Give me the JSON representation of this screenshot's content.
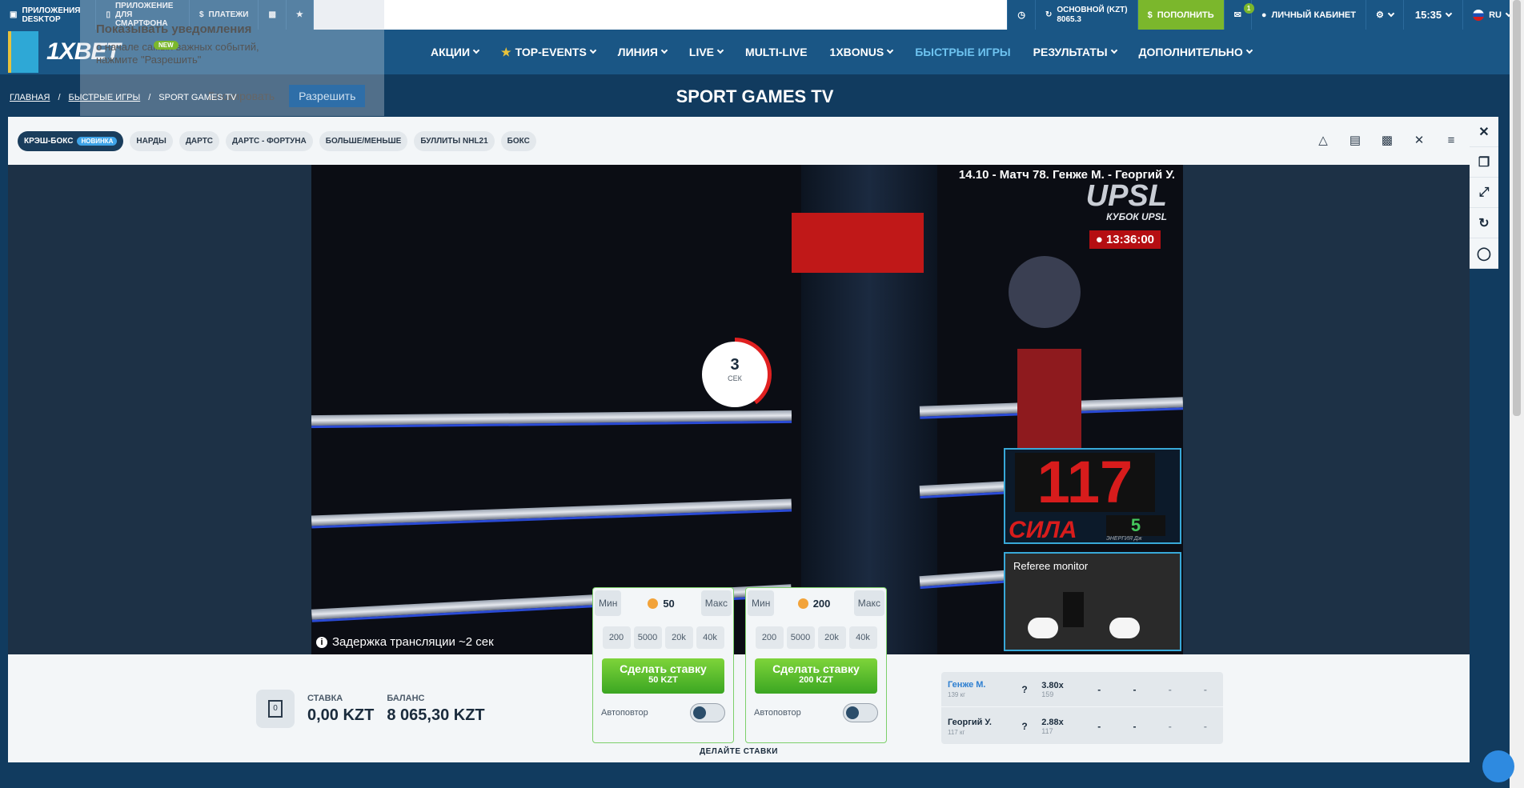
{
  "topbar": {
    "apps_desktop": "ПРИЛОЖЕНИЯ DESKTOP",
    "apps_phone": "ПРИЛОЖЕНИЕ ДЛЯ СМАРТФОНА",
    "payments": "ПЛАТЕЖИ",
    "account_type": "ОСНОВНОЙ (KZT)",
    "account_balance": "8065.3",
    "deposit": "ПОПОЛНИТЬ",
    "mail_count": "1",
    "cabinet": "ЛИЧНЫЙ КАБИНЕТ",
    "time": "15:35",
    "lang": "RU"
  },
  "logo": {
    "text": "1XBET",
    "badge": "NEW"
  },
  "nav": {
    "items": [
      "АКЦИИ",
      "TOP-EVENTS",
      "ЛИНИЯ",
      "LIVE",
      "MULTI-LIVE",
      "1XBONUS",
      "БЫСТРЫЕ ИГРЫ",
      "РЕЗУЛЬТАТЫ",
      "ДОПОЛНИТЕЛЬНО"
    ]
  },
  "notification": {
    "title": "Показывать уведомления",
    "text_line1": "о начале самых важных событий,",
    "text_line2": "нажмите \"Разрешить\"",
    "block": "Блокировать",
    "allow": "Разрешить"
  },
  "breadcrumb": {
    "home": "ГЛАВНАЯ",
    "fast_games": "БЫСТРЫЕ ИГРЫ",
    "current": "SPORT GAMES TV"
  },
  "page_title": "SPORT GAMES TV",
  "games": {
    "tabs": [
      "КРЭШ-БОКС",
      "НАРДЫ",
      "ДАРТС",
      "ДАРТС - ФОРТУНА",
      "БОЛЬШЕ/МЕНЬШЕ",
      "БУЛЛИТЫ NHL21",
      "БОКС"
    ],
    "new_badge": "НОВИНКА"
  },
  "video": {
    "match_title": "14.10 - Матч 78. Генже М. - Георгий У.",
    "brand": "UPSL",
    "cup": "КУБОК UPSL",
    "clock": "13:36:00",
    "power_value": "117",
    "power_label": "СИЛА",
    "energy_value": "5",
    "energy_label": "ЭНЕРГИЯ",
    "energy_unit": "Дж",
    "referee_monitor": "Referee monitor",
    "delay_text": "Задержка трансляции ~2 сек",
    "timer_value": "3",
    "timer_unit": "СЕК",
    "timer_progress": 0.4
  },
  "stake": {
    "stake_label": "СТАВКА",
    "stake_value": "0,00 KZT",
    "balance_label": "БАЛАНС",
    "balance_value": "8 065,30 KZT",
    "icon_value": "0"
  },
  "bet_panels": [
    {
      "min": "Мин",
      "max": "Макс",
      "amount": "50",
      "chips": [
        "200",
        "5000",
        "20k",
        "40k"
      ],
      "make_bet": "Сделать ставку",
      "make_bet_amount": "50 KZT",
      "autorepeat": "Автоповтор"
    },
    {
      "min": "Мин",
      "max": "Макс",
      "amount": "200",
      "chips": [
        "200",
        "5000",
        "20k",
        "40k"
      ],
      "make_bet": "Сделать ставку",
      "make_bet_amount": "200 KZT",
      "autorepeat": "Автоповтор"
    }
  ],
  "place_bets": "ДЕЛАЙТЕ СТАВКИ",
  "fighters": [
    {
      "name": "Генже М.",
      "weight": "139 кг",
      "q": "?",
      "coef": "3.80x",
      "sub": "159",
      "d1": "-",
      "d2": "-",
      "d3": "-",
      "d4": "-"
    },
    {
      "name": "Георгий У.",
      "weight": "117 кг",
      "q": "?",
      "coef": "2.88x",
      "sub": "117",
      "d1": "-",
      "d2": "-",
      "d3": "-",
      "d4": "-"
    }
  ],
  "colors": {
    "accent": "#1a5685",
    "green": "#7bb72c",
    "red": "#d81c1c",
    "active_nav": "#6ec3f0"
  }
}
